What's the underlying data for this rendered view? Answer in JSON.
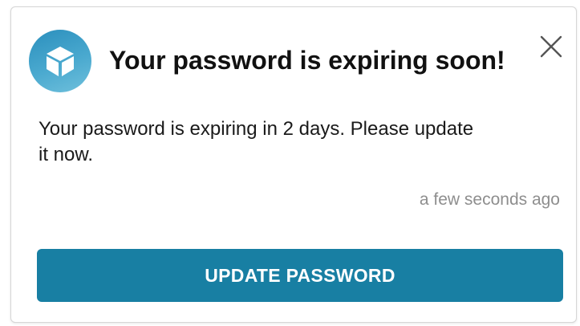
{
  "notification": {
    "title": "Your password is expiring soon!",
    "message": "Your password is expiring in 2 days. Please update it now.",
    "timestamp": "a few seconds ago",
    "action_label": "UPDATE PASSWORD",
    "app_icon": "cube-icon",
    "close_icon": "close-icon"
  },
  "colors": {
    "accent": "#187fa3",
    "icon_background": "#3b9fc9",
    "title_text": "#111111",
    "timestamp_text": "#8e8e8e"
  }
}
